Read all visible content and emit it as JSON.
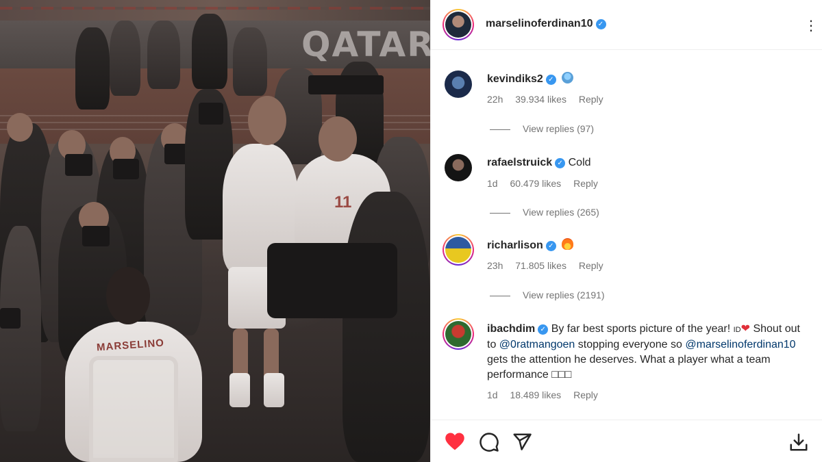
{
  "photo": {
    "board_text": "QATAR",
    "jersey_name": "MARSELINO",
    "jersey_number": "11"
  },
  "post": {
    "author": "marselinoferdinan10",
    "verified": true
  },
  "comments": [
    {
      "username": "kevindiks2",
      "verified": true,
      "text": "",
      "emoji": "face-emoji",
      "time": "22h",
      "likes": "39.934 likes",
      "reply_label": "Reply",
      "view_replies": "View replies (97)"
    },
    {
      "username": "rafaelstruick",
      "verified": true,
      "text": "Cold",
      "time": "1d",
      "likes": "60.479 likes",
      "reply_label": "Reply",
      "view_replies": "View replies (265)"
    },
    {
      "username": "richarlison",
      "verified": true,
      "text": "",
      "emoji": "fire-emoji",
      "time": "23h",
      "likes": "71.805 likes",
      "reply_label": "Reply",
      "view_replies": "View replies (2191)"
    },
    {
      "username": "ibachdim",
      "verified": true,
      "text_part1": "By far best sports picture of the year!",
      "flag_text": "ID",
      "text_part2": "Shout out to",
      "mention1": "@0ratmangoen",
      "text_part3": "stopping everyone so",
      "mention2": "@marselinoferdinan10",
      "text_part4": "gets the attention he deserves. What a player what a team performance",
      "trailing_glyphs": "□□□",
      "time": "1d",
      "likes": "18.489 likes",
      "reply_label": "Reply"
    }
  ],
  "actions": {
    "like": "heart-icon",
    "comment": "comment-icon",
    "share": "share-icon",
    "save": "download-icon"
  },
  "colors": {
    "verified": "#3897f0",
    "like_red": "#ff3040",
    "muted_text": "#737373",
    "mention": "#00376b"
  }
}
